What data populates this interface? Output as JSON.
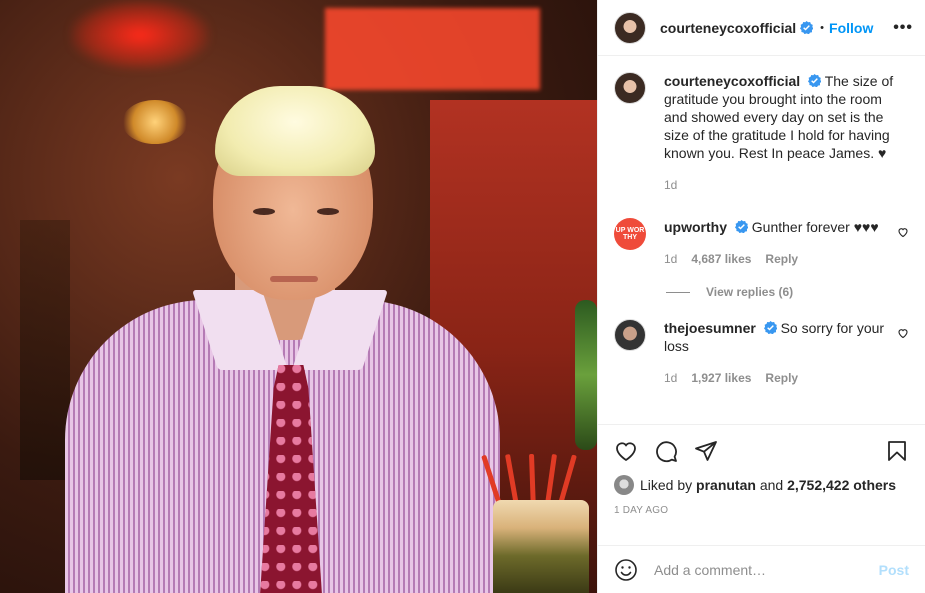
{
  "post": {
    "author": "courteneycoxofficial",
    "follow_label": "Follow",
    "dot": "•",
    "more_label": "•••",
    "caption": {
      "username": "courteneycoxofficial",
      "text": "The size of gratitude you brought into the room and showed every day on set is the size of the gratitude I hold for having known you. Rest In peace James. ♥",
      "age": "1d"
    },
    "comments": [
      {
        "username": "upworthy",
        "avatar_text": "UP WOR THY",
        "text": "Gunther forever ♥♥♥",
        "age": "1d",
        "likes": "4,687 likes",
        "reply_label": "Reply",
        "view_replies": "View replies (6)"
      },
      {
        "username": "thejoesumner",
        "text": "So sorry for your loss",
        "age": "1d",
        "likes": "1,927 likes",
        "reply_label": "Reply"
      }
    ],
    "liked_prefix": "Liked by",
    "liked_user": "pranutan",
    "liked_and": "and",
    "liked_count": "2,752,422 others",
    "date": "1 DAY AGO",
    "comment_placeholder": "Add a comment…",
    "post_label": "Post"
  },
  "colors": {
    "accent": "#0095f6",
    "post_disabled": "#b2dffc",
    "upworthy": "#ef4b3a"
  }
}
